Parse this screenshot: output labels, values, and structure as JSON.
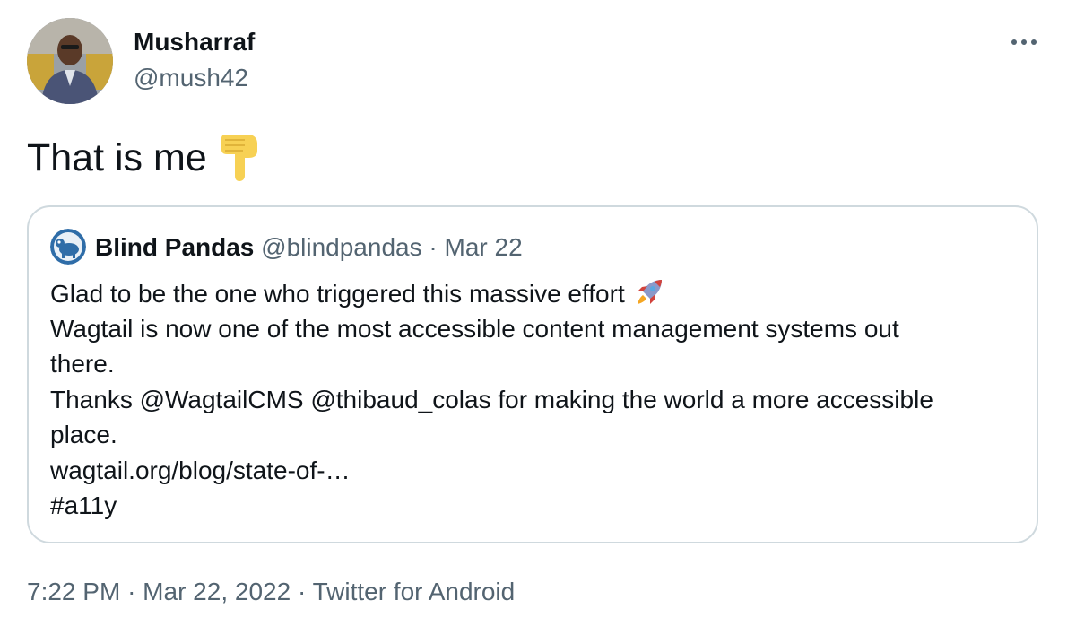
{
  "author": {
    "display_name": "Musharraf",
    "handle": "@mush42"
  },
  "tweet": {
    "text": "That is me",
    "emoji": "backhand-index-pointing-down"
  },
  "quoted_tweet": {
    "display_name": "Blind Pandas",
    "handle": "@blindpandas",
    "separator": "·",
    "date": "Mar 22",
    "lines": [
      "Glad to be the one who triggered this massive effort",
      "Wagtail is now one of the most accessible content management systems out",
      "there.",
      "Thanks @WagtailCMS  @thibaud_colas  for making the world a more accessible",
      "place.",
      "wagtail.org/blog/state-of-…",
      "#a11y"
    ],
    "emoji": "rocket"
  },
  "metadata": {
    "time": "7:22 PM",
    "sep1": "·",
    "date": "Mar 22, 2022",
    "sep2": "·",
    "source": "Twitter for Android"
  },
  "colors": {
    "text_primary": "#0f1419",
    "text_secondary": "#536471",
    "border": "#cfd9de"
  },
  "icons": {
    "more": "more-horizontal-icon"
  }
}
